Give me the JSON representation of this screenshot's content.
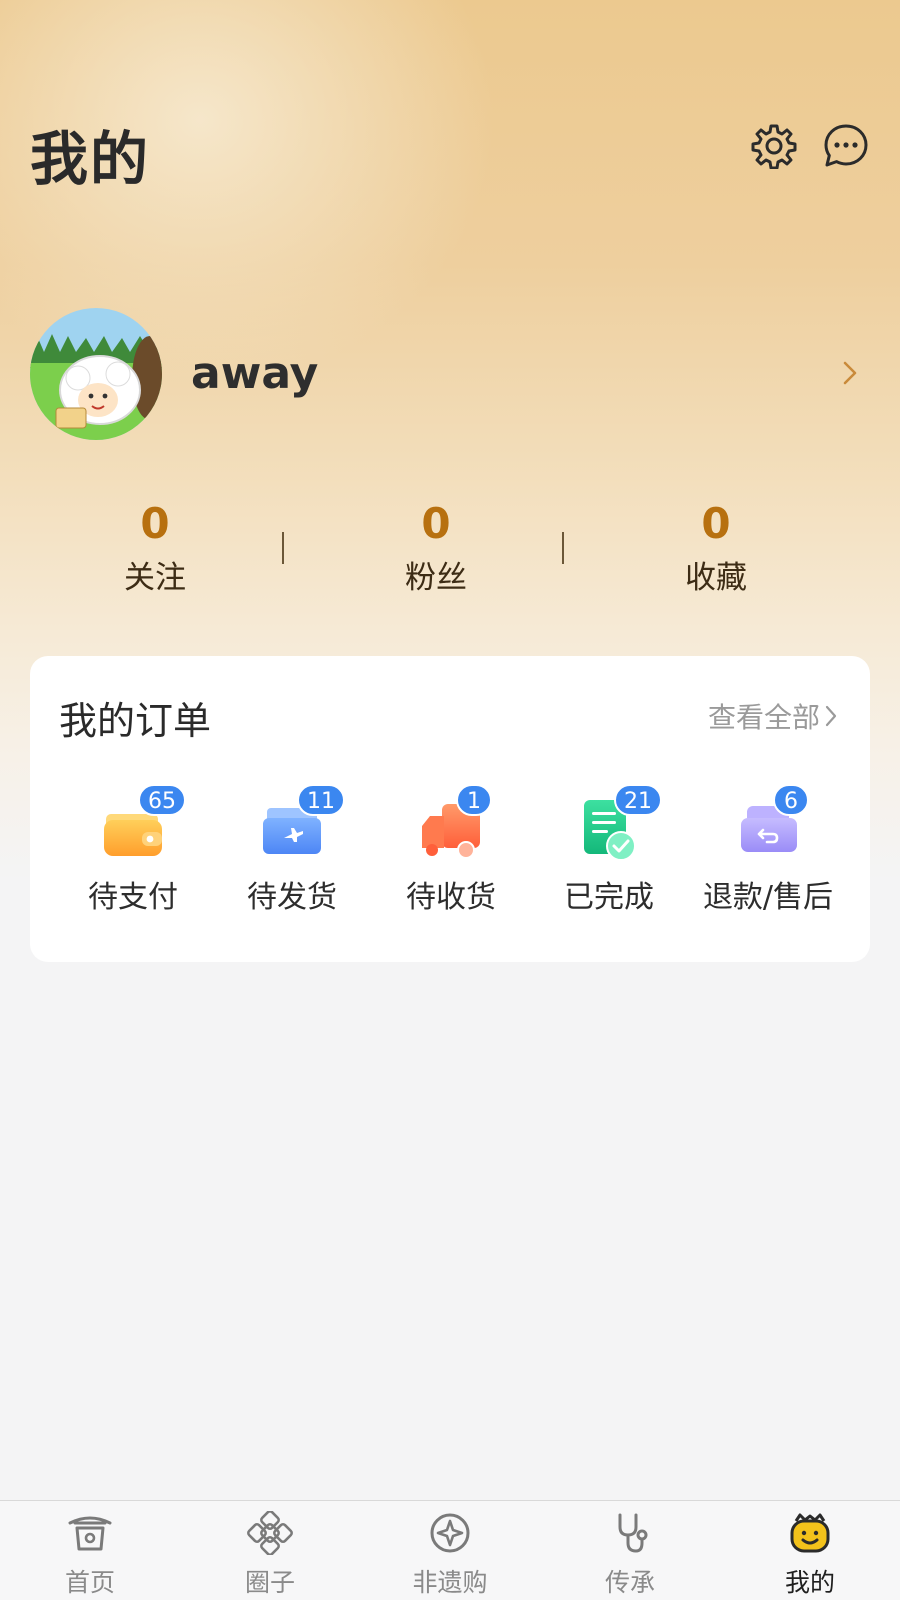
{
  "header": {
    "title": "我的"
  },
  "profile": {
    "username": "away"
  },
  "stats": [
    {
      "value": "0",
      "label": "关注"
    },
    {
      "value": "0",
      "label": "粉丝"
    },
    {
      "value": "0",
      "label": "收藏"
    }
  ],
  "orders": {
    "title": "我的订单",
    "view_all": "查看全部",
    "items": [
      {
        "label": "待支付",
        "count": "65",
        "icon": "wallet-icon"
      },
      {
        "label": "待发货",
        "count": "11",
        "icon": "airplane-box-icon"
      },
      {
        "label": "待收货",
        "count": "1",
        "icon": "truck-icon"
      },
      {
        "label": "已完成",
        "count": "21",
        "icon": "completed-document-icon"
      },
      {
        "label": "退款/售后",
        "count": "6",
        "icon": "refund-box-icon"
      }
    ]
  },
  "tabbar": {
    "items": [
      {
        "label": "首页",
        "icon": "pavilion-icon"
      },
      {
        "label": "圈子",
        "icon": "chinese-knot-icon"
      },
      {
        "label": "非遗购",
        "icon": "compass-star-icon"
      },
      {
        "label": "传承",
        "icon": "stethoscope-icon"
      },
      {
        "label": "我的",
        "icon": "tiger-face-icon",
        "active": true
      }
    ]
  },
  "colors": {
    "accent_number": "#b7700f",
    "badge": "#3b87f0",
    "header_gold": "#ecc98f"
  }
}
